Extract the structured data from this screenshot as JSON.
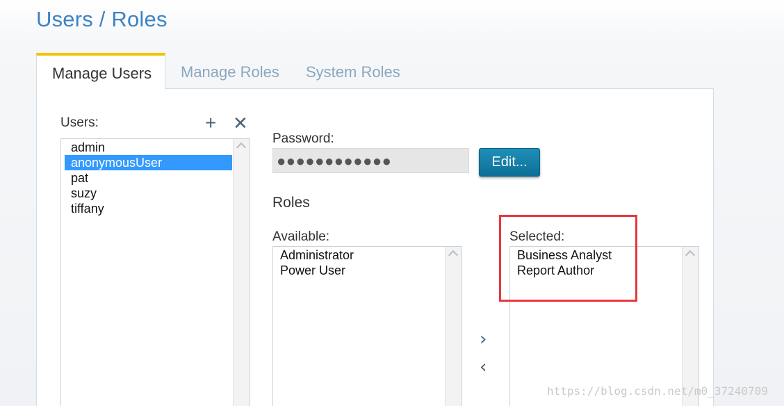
{
  "page": {
    "title": "Users / Roles"
  },
  "tabs": [
    {
      "label": "Manage Users",
      "active": true
    },
    {
      "label": "Manage Roles",
      "active": false
    },
    {
      "label": "System Roles",
      "active": false
    }
  ],
  "users": {
    "label": "Users:",
    "add_icon": "plus-icon",
    "remove_icon": "close-icon",
    "items": [
      "admin",
      "anonymousUser",
      "pat",
      "suzy",
      "tiffany"
    ],
    "selected": "anonymousUser"
  },
  "password": {
    "label": "Password:",
    "value": "●●●●●●●●●●●●",
    "edit_label": "Edit..."
  },
  "roles": {
    "heading": "Roles",
    "available_label": "Available:",
    "available": [
      "Administrator",
      "Power User"
    ],
    "selected_label": "Selected:",
    "selected": [
      "Business Analyst",
      "Report Author"
    ],
    "add_icon": "chevron-right-icon",
    "remove_icon": "chevron-left-icon"
  },
  "watermark": "https://blog.csdn.net/m0_37240709",
  "colors": {
    "accent": "#3d82c4",
    "tab_active_border": "#f1c400",
    "selection": "#3399ff",
    "button": "#1a7fa8",
    "highlight": "#e8383d"
  }
}
